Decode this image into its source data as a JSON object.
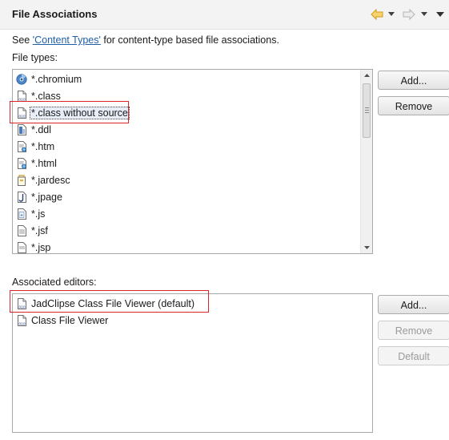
{
  "header": {
    "title": "File Associations"
  },
  "intro": {
    "prefix": "See ",
    "link": "'Content Types'",
    "suffix": " for content-type based file associations."
  },
  "file_types": {
    "label": "File types:",
    "items": [
      {
        "text": "*.chromium",
        "icon": "chromium-icon"
      },
      {
        "text": "*.class",
        "icon": "class-file-icon"
      },
      {
        "text": "*.class without source",
        "icon": "class-file-icon",
        "selected": true
      },
      {
        "text": "*.ddl",
        "icon": "ddl-file-icon"
      },
      {
        "text": "*.htm",
        "icon": "html-file-icon"
      },
      {
        "text": "*.html",
        "icon": "html-file-icon"
      },
      {
        "text": "*.jardesc",
        "icon": "jardesc-file-icon"
      },
      {
        "text": "*.jpage",
        "icon": "jpage-file-icon"
      },
      {
        "text": "*.js",
        "icon": "js-file-icon"
      },
      {
        "text": "*.jsf",
        "icon": "text-file-icon"
      },
      {
        "text": "*.jsp",
        "icon": "text-file-icon"
      }
    ],
    "buttons": {
      "add": "Add...",
      "remove": "Remove"
    }
  },
  "editors": {
    "label": "Associated editors:",
    "items": [
      {
        "text": "JadClipse Class File Viewer (default)",
        "icon": "class-file-icon"
      },
      {
        "text": "Class File Viewer",
        "icon": "class-file-icon"
      }
    ],
    "buttons": {
      "add": "Add...",
      "remove": "Remove",
      "default": "Default"
    }
  },
  "colors": {
    "highlight_box": "#d9262b",
    "link": "#1f5fa8",
    "nav_arrow": "#e0a419"
  }
}
